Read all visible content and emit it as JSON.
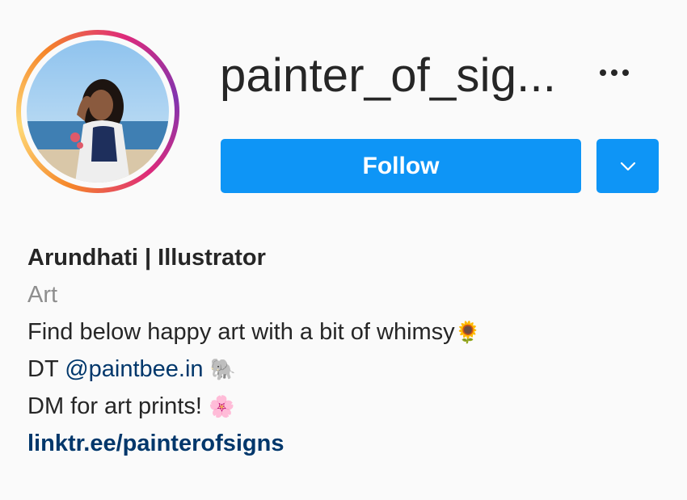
{
  "profile": {
    "username": "painter_of_sig...",
    "follow_label": "Follow",
    "more_icon": "more-horizontal-icon",
    "dropdown_icon": "chevron-down-icon"
  },
  "bio": {
    "name": "Arundhati | Illustrator",
    "category": "Art",
    "line1_text": "Find below happy art with a bit of whimsy",
    "line1_emoji": "🌻",
    "line2_prefix": "DT ",
    "line2_mention": "@paintbee.in",
    "line2_emoji": "🐘",
    "line3_text": "DM for art prints! ",
    "line3_emoji": "🌸",
    "link": "linktr.ee/painterofsigns"
  },
  "colors": {
    "accent": "#0e95f6",
    "link": "#00376b",
    "muted": "#8e8e8e"
  }
}
